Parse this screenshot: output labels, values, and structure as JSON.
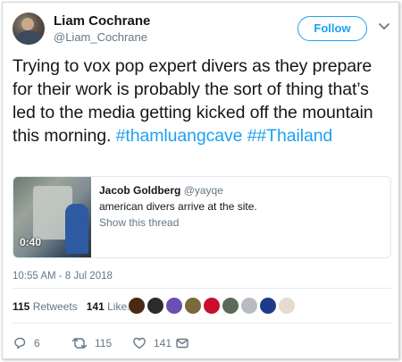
{
  "tweet": {
    "author_name": "Liam Cochrane",
    "author_handle": "@Liam_Cochrane",
    "follow_label": "Follow",
    "text_main": "Trying to vox pop expert divers as they prepare for their work is probably the sort of thing that’s led to the media getting kicked off the mountain this morning.",
    "hashtags": "#thamluangcave ##Thailand",
    "timestamp": "10:55 AM - 8 Jul 2018"
  },
  "quote": {
    "author_name": "Jacob Goldberg",
    "author_handle": "@yayqe",
    "text": "american divers arrive at the site.",
    "show_thread": "Show this thread",
    "video_duration": "0:40"
  },
  "stats": {
    "retweets_count": "115",
    "retweets_label": "Retweets",
    "likes_count": "141",
    "likes_label": "Likes"
  },
  "likers": [
    {
      "name": "liker-avatar-1",
      "color": "#4a2a14"
    },
    {
      "name": "liker-avatar-2",
      "color": "#2b2b2b"
    },
    {
      "name": "liker-avatar-3",
      "color": "#6a4fb0"
    },
    {
      "name": "liker-avatar-4",
      "color": "#7a6a3a"
    },
    {
      "name": "liker-avatar-5",
      "color": "#c8102e"
    },
    {
      "name": "liker-avatar-6",
      "color": "#5a6b5a"
    },
    {
      "name": "liker-avatar-7",
      "color": "#b8bcc0"
    },
    {
      "name": "liker-avatar-8",
      "color": "#1e3a8a"
    },
    {
      "name": "liker-avatar-9",
      "color": "#e5dccf"
    }
  ],
  "actions": {
    "reply_count": "6",
    "retweet_count": "115",
    "like_count": "141"
  },
  "colors": {
    "accent": "#1da1f2",
    "secondary_text": "#657786"
  }
}
